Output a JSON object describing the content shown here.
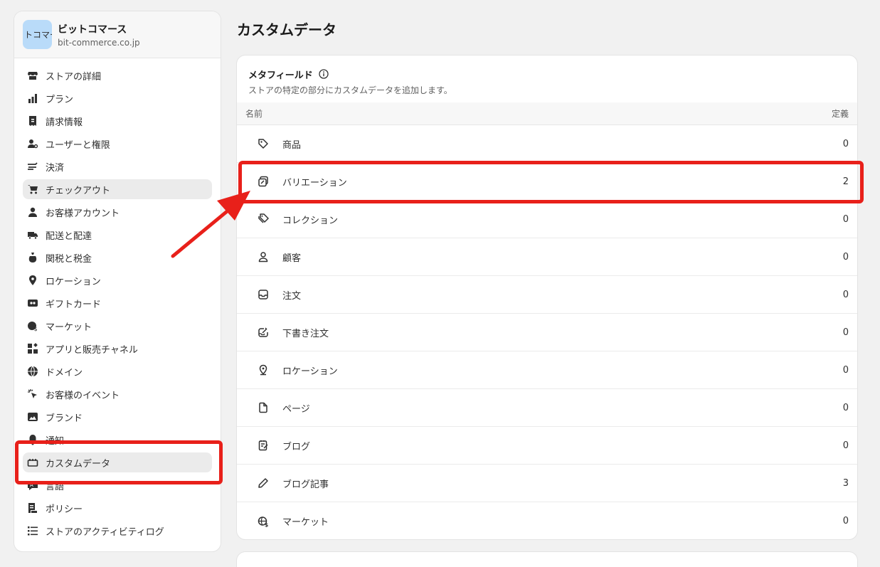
{
  "store": {
    "avatar_text": "トコマース",
    "name": "ビットコマース",
    "domain": "bit-commerce.co.jp"
  },
  "sidebar": {
    "items": [
      {
        "label": "ストアの詳細",
        "icon": "store-icon"
      },
      {
        "label": "プラン",
        "icon": "plan-chart-icon"
      },
      {
        "label": "請求情報",
        "icon": "receipt-icon"
      },
      {
        "label": "ユーザーと権限",
        "icon": "user-key-icon"
      },
      {
        "label": "決済",
        "icon": "payment-icon"
      },
      {
        "label": "チェックアウト",
        "icon": "cart-icon",
        "active": true
      },
      {
        "label": "お客様アカウント",
        "icon": "person-icon"
      },
      {
        "label": "配送と配達",
        "icon": "truck-icon"
      },
      {
        "label": "関税と税金",
        "icon": "money-bag-icon"
      },
      {
        "label": "ロケーション",
        "icon": "location-pin-icon"
      },
      {
        "label": "ギフトカード",
        "icon": "gift-card-icon"
      },
      {
        "label": "マーケット",
        "icon": "globe-dollar-icon"
      },
      {
        "label": "アプリと販売チャネル",
        "icon": "apps-icon"
      },
      {
        "label": "ドメイン",
        "icon": "globe-icon"
      },
      {
        "label": "お客様のイベント",
        "icon": "cursor-click-icon"
      },
      {
        "label": "ブランド",
        "icon": "image-icon"
      },
      {
        "label": "通知",
        "icon": "bell-icon"
      },
      {
        "label": "カスタムデータ",
        "icon": "custom-data-icon",
        "highlight": true
      },
      {
        "label": "言語",
        "icon": "language-icon"
      },
      {
        "label": "ポリシー",
        "icon": "policy-icon"
      },
      {
        "label": "ストアのアクティビティログ",
        "icon": "list-icon"
      }
    ]
  },
  "page": {
    "title": "カスタムデータ"
  },
  "metafields": {
    "title": "メタフィールド",
    "subtitle": "ストアの特定の部分にカスタムデータを追加します。",
    "col_name": "名前",
    "col_defs": "定義",
    "rows": [
      {
        "label": "商品",
        "count": "0",
        "icon": "tag-icon"
      },
      {
        "label": "バリエーション",
        "count": "2",
        "icon": "variant-icon"
      },
      {
        "label": "コレクション",
        "count": "0",
        "icon": "collection-tags-icon"
      },
      {
        "label": "顧客",
        "count": "0",
        "icon": "person-outline-icon"
      },
      {
        "label": "注文",
        "count": "0",
        "icon": "inbox-icon"
      },
      {
        "label": "下書き注文",
        "count": "0",
        "icon": "draft-order-icon"
      },
      {
        "label": "ロケーション",
        "count": "0",
        "icon": "location-outline-icon"
      },
      {
        "label": "ページ",
        "count": "0",
        "icon": "page-icon"
      },
      {
        "label": "ブログ",
        "count": "0",
        "icon": "blog-icon"
      },
      {
        "label": "ブログ記事",
        "count": "3",
        "icon": "pencil-icon"
      },
      {
        "label": "マーケット",
        "count": "0",
        "icon": "globe-dollar-outline-icon"
      }
    ]
  },
  "colors": {
    "accent_red": "#e8201a",
    "active_bg": "#ebebeb"
  }
}
